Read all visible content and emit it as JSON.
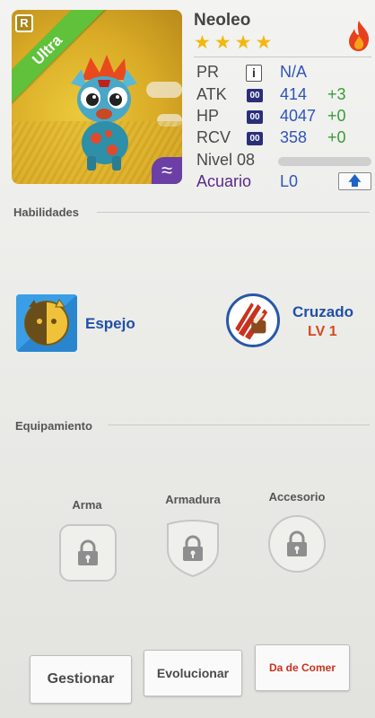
{
  "monster": {
    "name": "Neoleo",
    "stars": 4,
    "rarity": "Ultra",
    "rank_badge": "R",
    "element_icon": "water-wave-icon",
    "type_icon": "fire-icon"
  },
  "stats": {
    "pr": {
      "label": "PR",
      "value": "N/A"
    },
    "atk": {
      "label": "ATK",
      "badge": "00",
      "value": "414",
      "bonus": "+3"
    },
    "hp": {
      "label": "HP",
      "badge": "00",
      "value": "4047",
      "bonus": "+0"
    },
    "rcv": {
      "label": "RCV",
      "badge": "00",
      "value": "358",
      "bonus": "+0"
    },
    "level": {
      "label": "Nivel 08"
    },
    "aquarium": {
      "label": "Acuario",
      "value": "L0"
    }
  },
  "skills": {
    "title": "Habilidades",
    "items": [
      {
        "name": "Espejo",
        "icon": "mirror-cat-icon"
      },
      {
        "name": "Cruzado",
        "level": "LV 1",
        "icon": "claw-slash-icon"
      }
    ]
  },
  "equipment": {
    "title": "Equipamiento",
    "slots": [
      {
        "label": "Arma",
        "icon": "lock-icon"
      },
      {
        "label": "Armadura",
        "icon": "lock-icon"
      },
      {
        "label": "Accesorio",
        "icon": "lock-icon"
      }
    ]
  },
  "actions": {
    "manage": "Gestionar",
    "evolve": "Evolucionar",
    "feed": "Da de Comer"
  },
  "colors": {
    "rarity_green": "#5fc23a",
    "stat_value_blue": "#2f55b8",
    "bonus_green": "#3a9c3a",
    "skill_blue": "#1f4fa8",
    "skill_level_red": "#d24a1f",
    "feed_red": "#c8321e",
    "aquarium_purple": "#5a2a8a"
  }
}
